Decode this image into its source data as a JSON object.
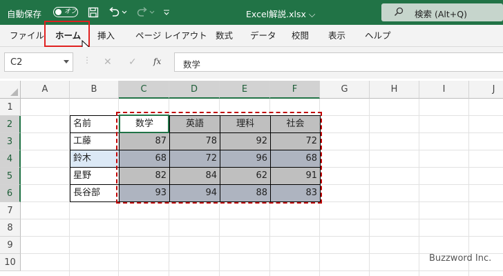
{
  "titlebar": {
    "autosave_label": "自動保存",
    "toggle_label": "オフ",
    "filename": "Excel解説.xlsx",
    "search_placeholder": "検索 (Alt+Q)",
    "accent_color": "#217346"
  },
  "ribbon": {
    "tabs": [
      "ファイル",
      "ホーム",
      "挿入",
      "ページ レイアウト",
      "数式",
      "データ",
      "校閲",
      "表示",
      "ヘルプ"
    ],
    "active_tab": "ホーム"
  },
  "formula_bar": {
    "name_box": "C2",
    "formula": "数学"
  },
  "sheet": {
    "columns": [
      "A",
      "B",
      "C",
      "D",
      "E",
      "F",
      "G",
      "H",
      "I",
      "J"
    ],
    "rows": [
      "1",
      "2",
      "3",
      "4",
      "5",
      "6",
      "7",
      "8",
      "9",
      "10"
    ],
    "selected_columns": [
      "C",
      "D",
      "E",
      "F"
    ],
    "selected_rows": [
      "2",
      "3",
      "4",
      "5",
      "6"
    ],
    "table": {
      "headers": [
        "名前",
        "数学",
        "英語",
        "理科",
        "社会"
      ],
      "rows": [
        {
          "name": "工藤",
          "values": [
            "87",
            "78",
            "92",
            "72"
          ]
        },
        {
          "name": "鈴木",
          "values": [
            "68",
            "72",
            "96",
            "68"
          ]
        },
        {
          "name": "星野",
          "values": [
            "82",
            "84",
            "62",
            "91"
          ]
        },
        {
          "name": "長谷部",
          "values": [
            "93",
            "94",
            "88",
            "83"
          ]
        }
      ]
    }
  },
  "watermark": "Buzzword Inc."
}
